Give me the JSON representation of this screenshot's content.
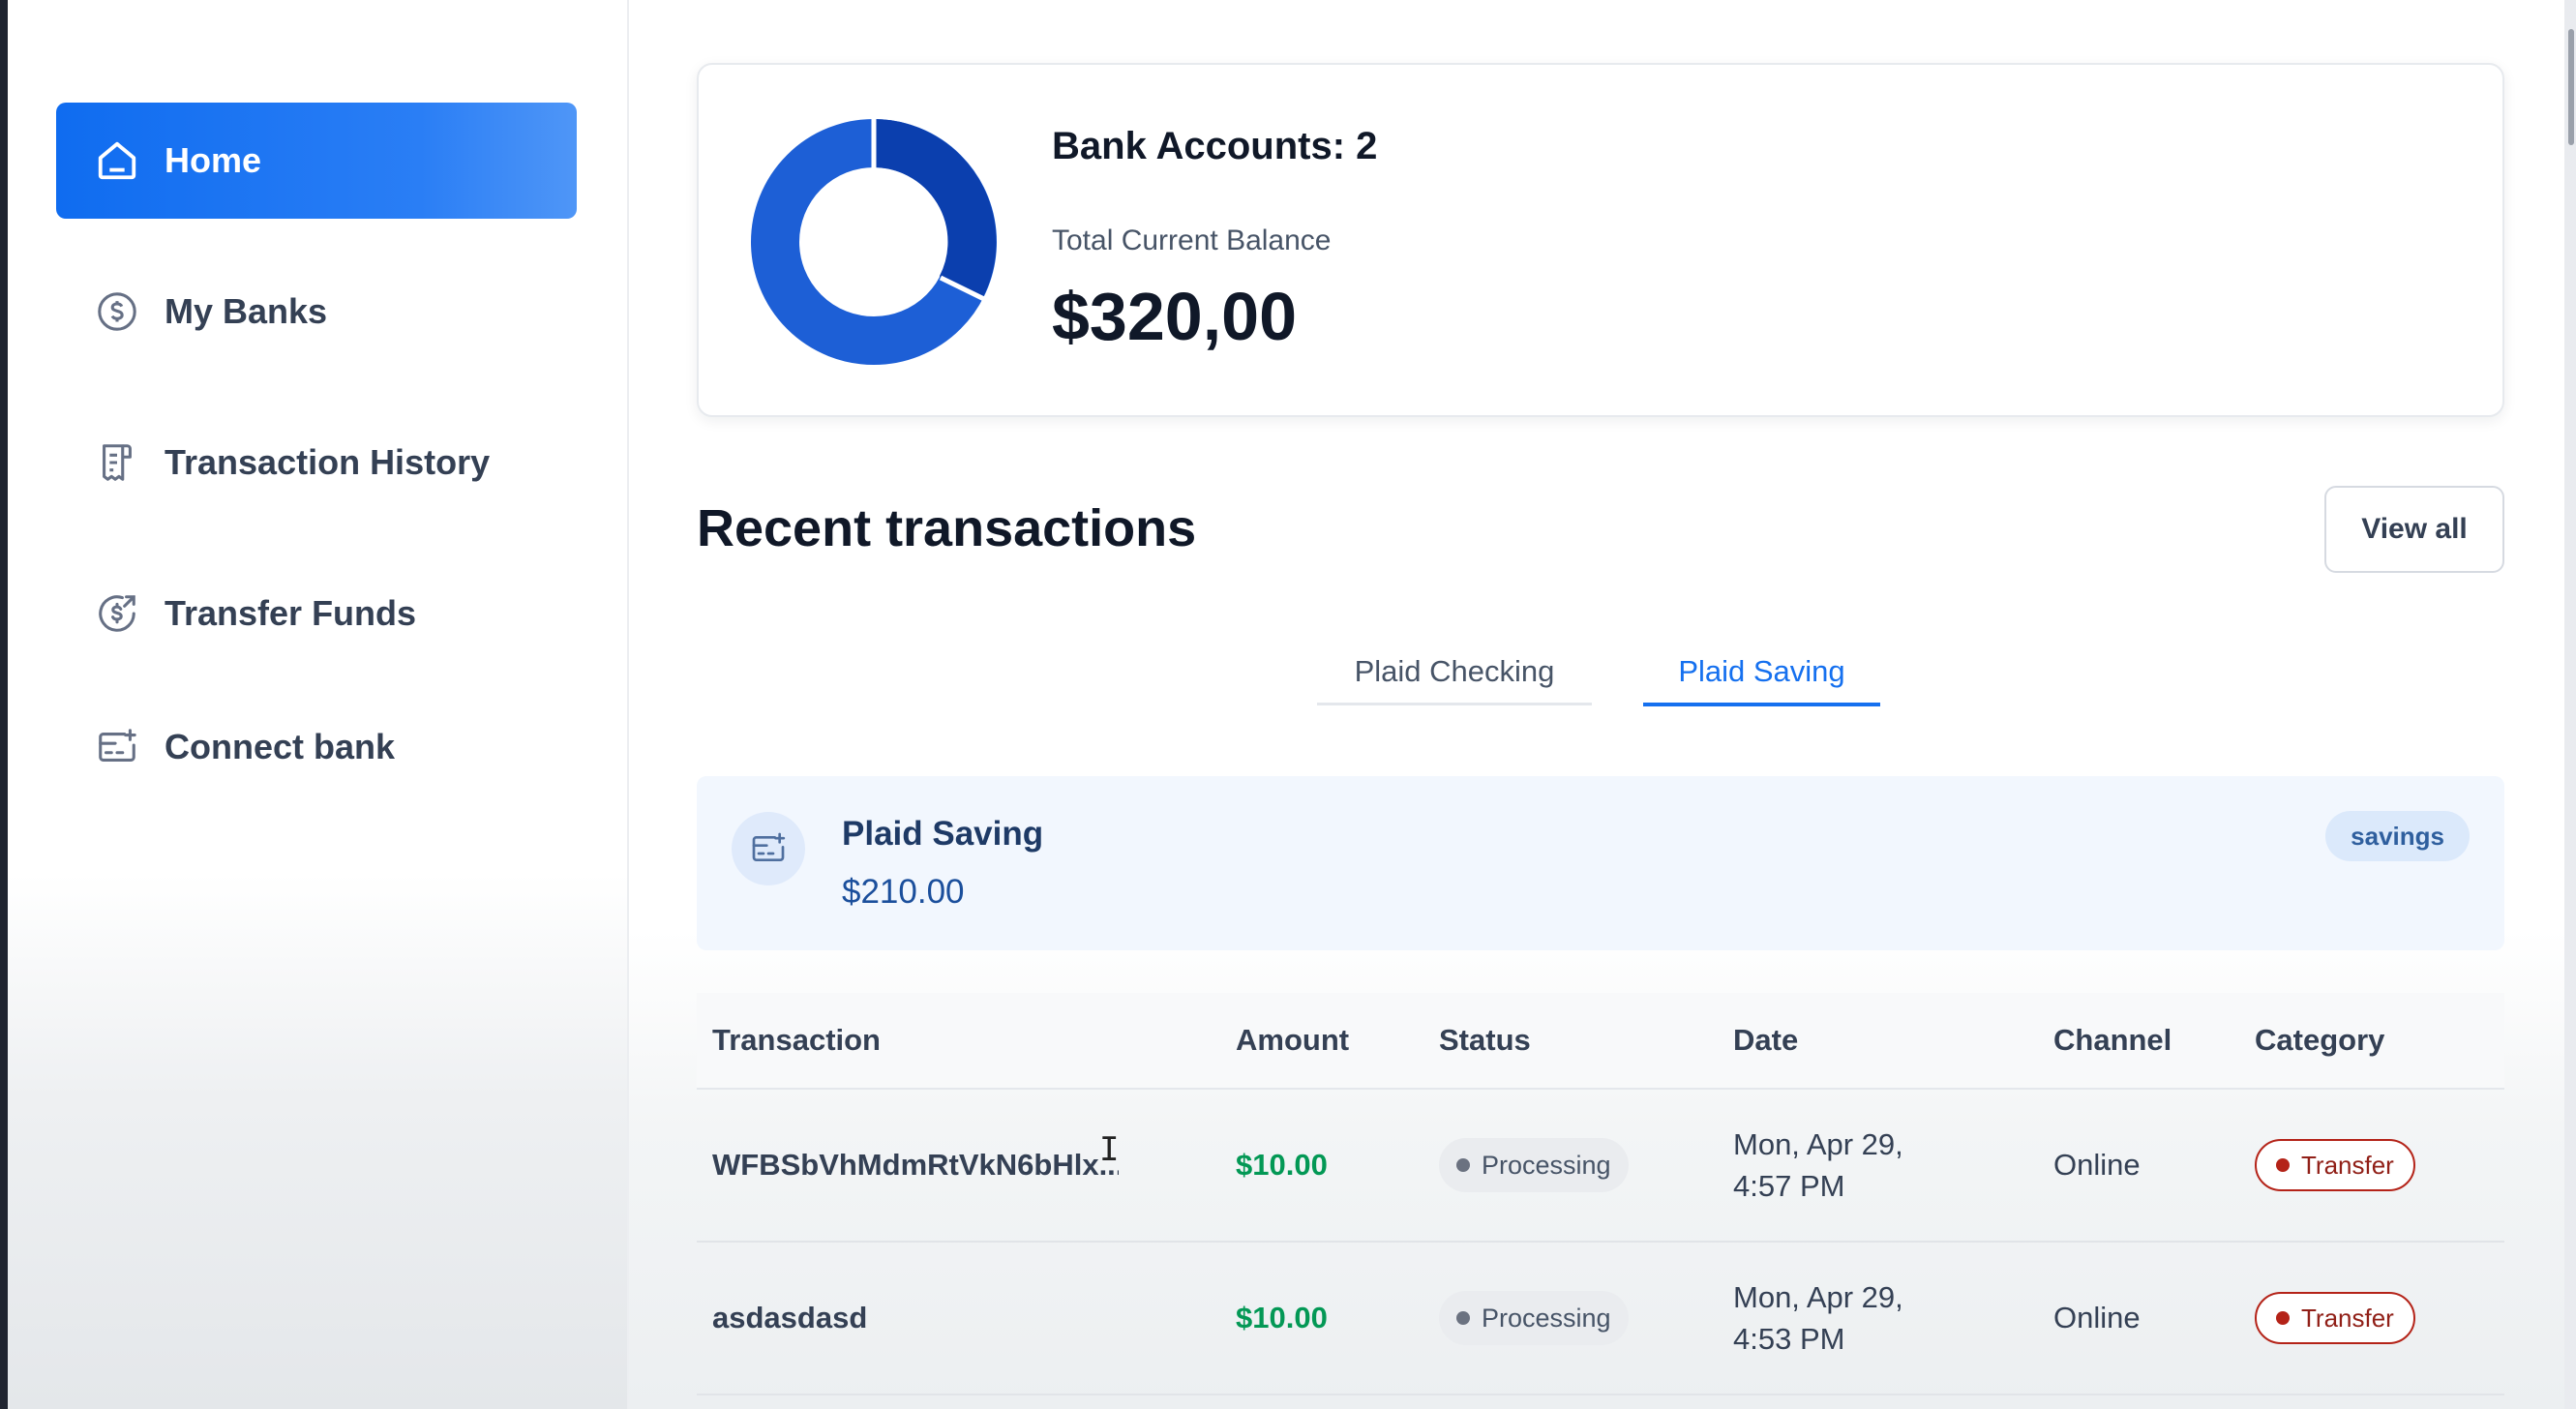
{
  "sidebar": {
    "items": [
      {
        "label": "Home",
        "icon": "home-icon",
        "active": true
      },
      {
        "label": "My Banks",
        "icon": "dollar-circle-icon",
        "active": false
      },
      {
        "label": "Transaction History",
        "icon": "receipt-icon",
        "active": false
      },
      {
        "label": "Transfer Funds",
        "icon": "transfer-dollar-icon",
        "active": false
      },
      {
        "label": "Connect bank",
        "icon": "card-add-icon",
        "active": false
      }
    ]
  },
  "balance_card": {
    "accounts_label": "Bank Accounts: 2",
    "total_label": "Total Current Balance",
    "total_amount": "$320,00"
  },
  "recent": {
    "title": "Recent transactions",
    "view_all_label": "View all",
    "tabs": [
      {
        "label": "Plaid Checking",
        "active": false
      },
      {
        "label": "Plaid Saving",
        "active": true
      }
    ],
    "account": {
      "name": "Plaid Saving",
      "balance": "$210.00",
      "type": "savings"
    },
    "columns": [
      "Transaction",
      "Amount",
      "Status",
      "Date",
      "Channel",
      "Category"
    ],
    "rows": [
      {
        "name": "WFBSbVhMdmRtVkN6bHlx...",
        "amount": "$10.00",
        "status": "Processing",
        "date_line1": "Mon, Apr 29,",
        "date_line2": "4:57 PM",
        "channel": "Online",
        "category": "Transfer"
      },
      {
        "name": "asdasdasd",
        "amount": "$10.00",
        "status": "Processing",
        "date_line1": "Mon, Apr 29,",
        "date_line2": "4:53 PM",
        "channel": "Online",
        "category": "Transfer"
      }
    ]
  },
  "colors": {
    "accent": "#1570ef",
    "donut_primary": "#1d5fd6",
    "donut_dark": "#0b3fae",
    "amount_green": "#039855",
    "category_red": "#b42318"
  }
}
